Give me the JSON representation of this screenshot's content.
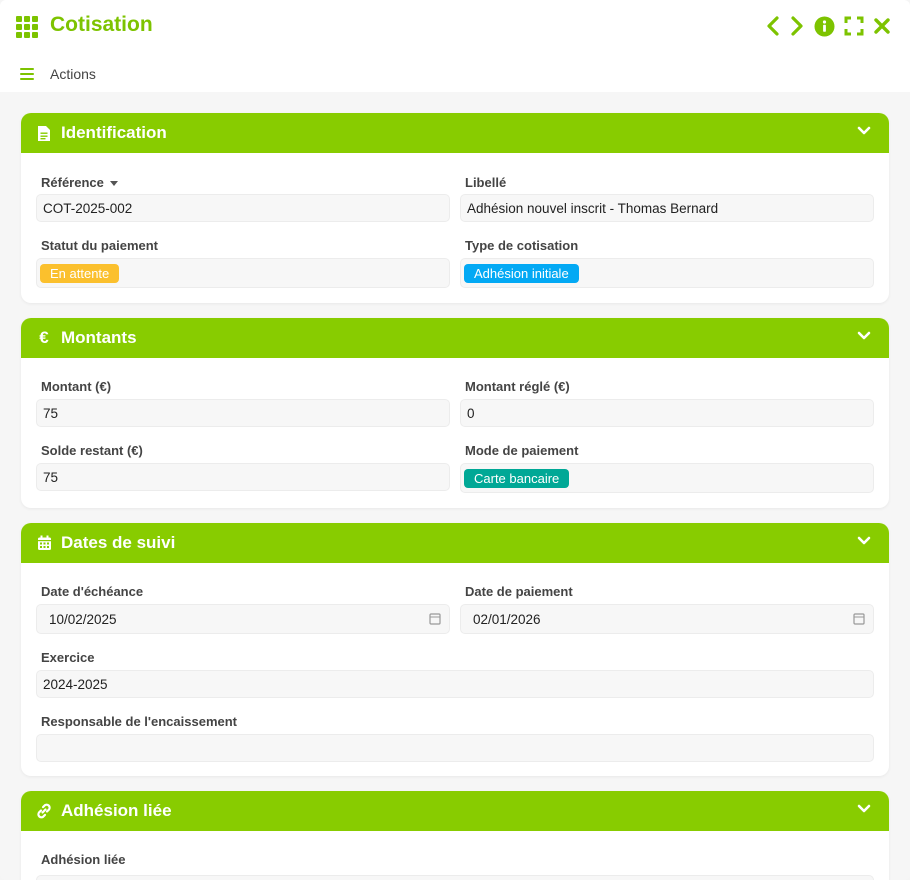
{
  "window": {
    "title": "Cotisation"
  },
  "toolbar": {
    "actions_label": "Actions"
  },
  "colors": {
    "accent": "#88cc00",
    "title": "#7dc300",
    "status_pending": "#fbc02d",
    "type_badge": "#03a9f4",
    "payment_badge": "#00a896"
  },
  "sections": {
    "identification": {
      "title": "Identification",
      "reference_label": "Référence",
      "reference_value": "COT-2025-002",
      "libelle_label": "Libellé",
      "libelle_value": "Adhésion nouvel inscrit - Thomas Bernard",
      "statut_label": "Statut du paiement",
      "statut_value": "En attente",
      "type_label": "Type de cotisation",
      "type_value": "Adhésion initiale"
    },
    "montants": {
      "title": "Montants",
      "montant_label": "Montant (€)",
      "montant_value": "75",
      "regle_label": "Montant réglé (€)",
      "regle_value": "0",
      "solde_label": "Solde restant (€)",
      "solde_value": "75",
      "mode_label": "Mode de paiement",
      "mode_value": "Carte bancaire"
    },
    "dates": {
      "title": "Dates de suivi",
      "echeance_label": "Date d'échéance",
      "echeance_value": "10/02/2025",
      "paiement_label": "Date de paiement",
      "paiement_value": "02/01/2026",
      "exercice_label": "Exercice",
      "exercice_value": "2024-2025",
      "responsable_label": "Responsable de l'encaissement",
      "responsable_value": ""
    },
    "adhesion": {
      "title": "Adhésion liée",
      "adhesion_label": "Adhésion liée"
    }
  }
}
